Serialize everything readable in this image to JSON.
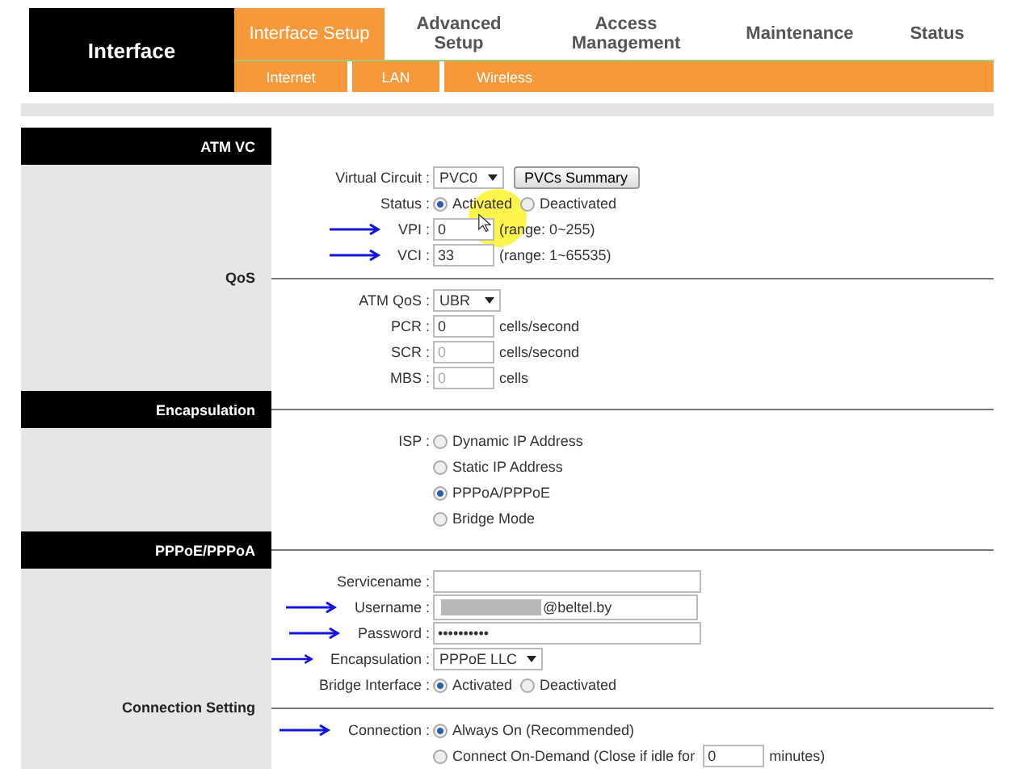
{
  "brand": "Interface",
  "tabs": [
    {
      "label": "Interface Setup",
      "selected": true
    },
    {
      "label": "Advanced Setup",
      "selected": false
    },
    {
      "label": "Access Management",
      "selected": false
    },
    {
      "label": "Maintenance",
      "selected": false
    },
    {
      "label": "Status",
      "selected": false
    }
  ],
  "subtabs": [
    "Internet",
    "LAN",
    "Wireless"
  ],
  "sections": [
    {
      "title": "ATM VC",
      "kind": "dark",
      "rows": [
        {
          "label": "Virtual Circuit :",
          "items": [
            {
              "kind": "select",
              "value": "PVC0"
            },
            {
              "kind": "button",
              "label": "PVCs Summary"
            }
          ]
        },
        {
          "label": "Status :",
          "pointer": true,
          "items": [
            {
              "kind": "radio",
              "label": "Activated",
              "selected": true
            },
            {
              "kind": "radio",
              "label": "Deactivated",
              "selected": false
            }
          ]
        },
        {
          "label": "VPI :",
          "arrow": true,
          "items": [
            {
              "kind": "field",
              "value": "0"
            },
            {
              "kind": "note",
              "text": "(range: 0~255)"
            }
          ]
        },
        {
          "label": "VCI :",
          "arrow": true,
          "items": [
            {
              "kind": "field",
              "value": "33"
            },
            {
              "kind": "note",
              "text": "(range: 1~65535)"
            }
          ]
        }
      ]
    },
    {
      "title": "QoS",
      "kind": "light",
      "rows": [
        {
          "label": "ATM QoS :",
          "items": [
            {
              "kind": "select",
              "value": "UBR"
            }
          ]
        },
        {
          "label": "PCR :",
          "items": [
            {
              "kind": "field",
              "value": "0",
              "disabled": false
            },
            {
              "kind": "note",
              "text": "cells/second"
            }
          ]
        },
        {
          "label": "SCR :",
          "items": [
            {
              "kind": "field",
              "value": "0",
              "disabled": true
            },
            {
              "kind": "note",
              "text": "cells/second"
            }
          ]
        },
        {
          "label": "MBS :",
          "items": [
            {
              "kind": "field",
              "value": "0",
              "disabled": true
            },
            {
              "kind": "note",
              "text": "cells"
            }
          ]
        }
      ]
    },
    {
      "title": "Encapsulation",
      "kind": "dark",
      "rows": [
        {
          "label": "ISP :",
          "items": [
            {
              "kind": "radio",
              "label": "Dynamic IP Address",
              "selected": false
            }
          ]
        },
        {
          "items": [
            {
              "kind": "radio",
              "label": "Static IP Address",
              "selected": false
            }
          ]
        },
        {
          "items": [
            {
              "kind": "radio",
              "label": "PPPoA/PPPoE",
              "selected": true
            }
          ]
        },
        {
          "items": [
            {
              "kind": "radio",
              "label": "Bridge Mode",
              "selected": false
            }
          ]
        }
      ]
    },
    {
      "title": "PPPoE/PPPoA",
      "kind": "dark",
      "rows": [
        {
          "label": "Servicename :",
          "items": [
            {
              "kind": "wide_field",
              "value": ""
            }
          ]
        },
        {
          "label": "Username :",
          "arrow": true,
          "items": [
            {
              "kind": "redacted_field",
              "value": "@beltel.by"
            }
          ]
        },
        {
          "label": "Password :",
          "arrow": true,
          "items": [
            {
              "kind": "wide_field",
              "value": "••••••••••"
            }
          ]
        },
        {
          "label": "Encapsulation :",
          "arrow": true,
          "items": [
            {
              "kind": "select",
              "value": "PPPoE LLC"
            }
          ]
        },
        {
          "label": "Bridge Interface :",
          "items": [
            {
              "kind": "radio",
              "label": "Activated",
              "selected": true
            },
            {
              "kind": "radio",
              "label": "Deactivated",
              "selected": false
            }
          ]
        }
      ]
    },
    {
      "title": "Connection Setting",
      "kind": "light",
      "rows": [
        {
          "label": "Connection :",
          "arrow": true,
          "items": [
            {
              "kind": "radio",
              "label": "Always On (Recommended)",
              "selected": true
            }
          ]
        },
        {
          "items": [
            {
              "kind": "radio",
              "label": "Connect On-Demand (Close if idle for",
              "selected": false
            },
            {
              "kind": "field",
              "value": "0"
            },
            {
              "kind": "note",
              "text": "minutes)"
            }
          ]
        }
      ]
    }
  ]
}
